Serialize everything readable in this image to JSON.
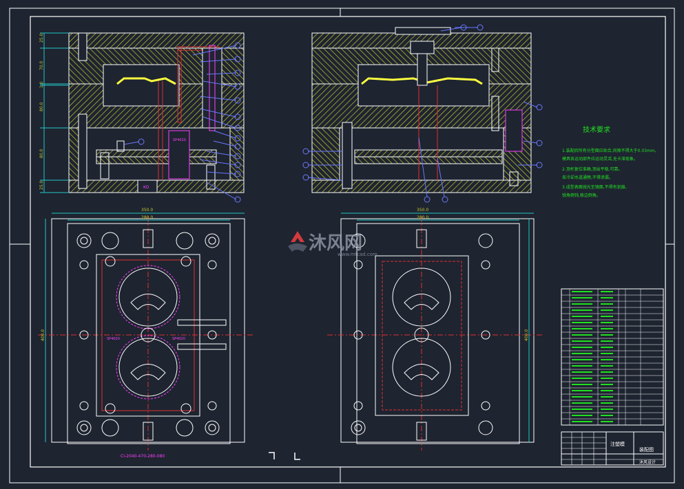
{
  "colors": {
    "background": "#1e2430",
    "frame": "#ffffff",
    "plate_hatch": "#c8c832",
    "dimension": "#22c8c8",
    "centerline": "#e03030",
    "balloon": "#6a78ff",
    "magenta": "#ff40ff",
    "outline": "#ffffff",
    "notes_green": "#22e022"
  },
  "icons": {
    "watermark_logo": "mfcad-logo-icon"
  },
  "dims": {
    "width_outer_left": "350.0",
    "width_inner_left": "280.0",
    "width_outer_right": "350.0",
    "width_inner_right": "280.0",
    "height_left": "400.0",
    "height_right": "400.0"
  },
  "plate_labels_left": [
    "25.0",
    "70.0",
    "1.0",
    "80.0",
    "80.0",
    "25.0"
  ],
  "tech": {
    "title": "技术要求",
    "lines": [
      "1.装配后所有分型面应贴合,间隙不得大于0.03mm,",
      "  模具各运动部件应运动灵活,无卡滞现象。",
      "2.顶杆复位准确,顶出平稳,可靠。",
      "  各冷却水道通畅,不得渗漏。",
      "3.成型表面抛光至镜面,不得有划痕、",
      "  锐角倒钝,棱边倒角。"
    ]
  },
  "labels": {
    "part_tag_left": "CI-2040-470-280-080",
    "spec_box": "SP4020",
    "spec_small_a": "SP4020",
    "spec_small_b": "SP4020",
    "kick_box": "KO",
    "watermark": "沐风网",
    "watermark_url": "www.mfcad.com"
  },
  "title_block": {
    "name": "注塑模",
    "drawing": "装配图",
    "company": "沐风设计"
  },
  "bom_rows": 22
}
